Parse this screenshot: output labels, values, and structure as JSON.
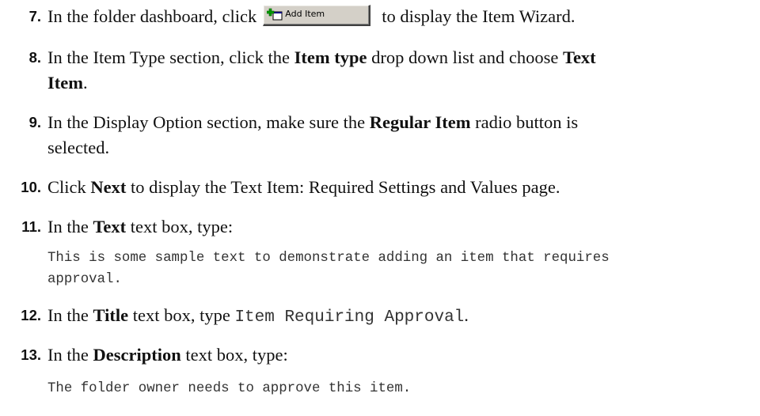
{
  "steps": [
    {
      "number": "7.",
      "lines": [
        [
          "In the folder dashboard, click",
          "to display the Item Wizard."
        ]
      ],
      "button_label": "Add Item"
    },
    {
      "number": "8.",
      "line1": {
        "t1": "In the Item Type section, click the ",
        "b1": "Item type",
        "t2": " drop down list and choose ",
        "b2": "Text"
      },
      "line2": {
        "b1": "Item",
        "t1": "."
      }
    },
    {
      "number": "9.",
      "line1": {
        "t1": "In the Display Option section, make sure the ",
        "b1": "Regular Item",
        "t2": " radio button is"
      },
      "line2": {
        "t1": "selected."
      }
    },
    {
      "number": "10.",
      "line1": {
        "t1": "Click ",
        "b1": "Next",
        "t2": " to display the Text Item: Required Settings and Values page."
      }
    },
    {
      "number": "11.",
      "line1": {
        "t1": "In the ",
        "b1": "Text",
        "t2": " text box, type:"
      },
      "code": [
        "This is some sample text to demonstrate adding an item that requires",
        "approval."
      ]
    },
    {
      "number": "12.",
      "line1": {
        "t1": "In the ",
        "b1": "Title",
        "t2": " text box, type ",
        "mono": "Item Requiring Approval",
        "t3": "."
      }
    },
    {
      "number": "13.",
      "line1": {
        "t1": "In the ",
        "b1": "Description",
        "t2": " text box, type:"
      },
      "code": [
        "The folder owner needs to approve this item."
      ]
    }
  ]
}
